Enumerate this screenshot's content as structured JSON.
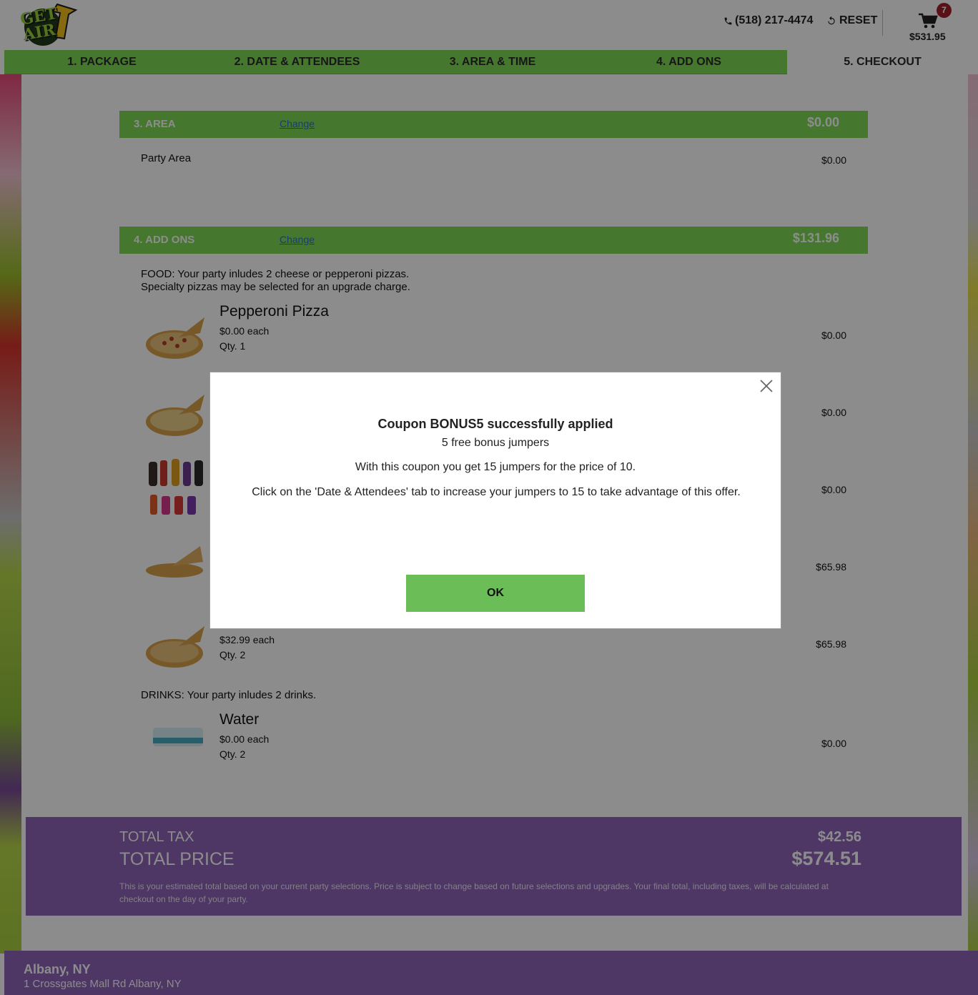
{
  "header": {
    "logo_text_line1": "GET",
    "logo_text_line2": "AIR",
    "phone": "(518) 217-4474",
    "reset_label": "RESET",
    "cart_count": "7",
    "cart_total": "$531.95"
  },
  "tabs": [
    {
      "label": "1. PACKAGE"
    },
    {
      "label": "2. DATE & ATTENDEES"
    },
    {
      "label": "3. AREA & TIME"
    },
    {
      "label": "4. ADD ONS"
    },
    {
      "label": "5. CHECKOUT"
    }
  ],
  "area_section": {
    "title": "3. AREA",
    "change_label": "Change",
    "price": "$0.00",
    "line_name": "Party Area",
    "line_price": "$0.00"
  },
  "addons_section": {
    "title": "4. ADD ONS",
    "change_label": "Change",
    "price": "$131.96",
    "food_note_1": "FOOD: Your party inludes 2 cheese or pepperoni pizzas.",
    "food_note_2": "Specialty pizzas may be selected for an upgrade charge.",
    "items": [
      {
        "name": "Pepperoni Pizza",
        "each": "$0.00 each",
        "qty": "Qty. 1",
        "price": "$0.00"
      },
      {
        "price": "$0.00"
      },
      {
        "price": "$0.00"
      },
      {
        "price": "$65.98"
      },
      {
        "each": "$32.99 each",
        "qty": "Qty. 2",
        "price": "$65.98"
      }
    ],
    "drinks_note": "DRINKS: Your party inludes 2 drinks.",
    "drink": {
      "name": "Water",
      "each": "$0.00 each",
      "qty": "Qty. 2",
      "price": "$0.00"
    }
  },
  "totals": {
    "tax_label": "TOTAL TAX",
    "tax_value": "$42.56",
    "price_label": "TOTAL PRICE",
    "price_value": "$574.51",
    "note": "This is your estimated total based on your current party selections. Price is subject to change based on future selections and upgrades. Your final total, including taxes, will be calculated at checkout on the day of your party."
  },
  "footer": {
    "city": "Albany, NY",
    "address": "1 Crossgates Mall Rd Albany, NY"
  },
  "modal": {
    "title": "Coupon BONUS5 successfully applied",
    "subtitle": "5 free bonus jumpers",
    "line1": "With this coupon you get 15 jumpers for the price of 10.",
    "line2": "Click on the 'Date & Attendees' tab to increase your jumpers to 15 to take advantage of this offer.",
    "ok_label": "OK"
  },
  "colors": {
    "accent_green": "#7ed957",
    "purple": "#8e63b8",
    "badge_red": "#a31f2c",
    "ok_green": "#6bbd57"
  }
}
